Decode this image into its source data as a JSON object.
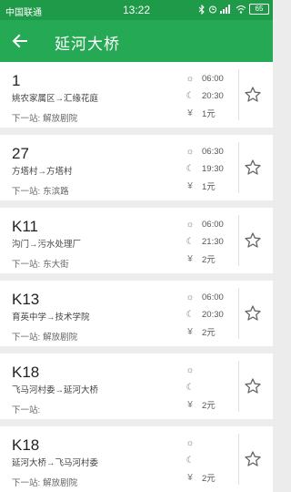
{
  "status_bar": {
    "carrier": "中国联通",
    "time": "13:22",
    "battery": "65"
  },
  "app_bar": {
    "title": "延河大桥"
  },
  "routes": [
    {
      "number": "1",
      "from": "姚农家属区",
      "arrow": "→",
      "to": "汇缘花庭",
      "next_label": "下一站:",
      "next_stop": "解放剧院",
      "first_bus": "06:00",
      "last_bus": "20:30",
      "fare": "1元"
    },
    {
      "number": "27",
      "from": "方塔村",
      "arrow": "→",
      "to": "方塔村",
      "next_label": "下一站:",
      "next_stop": "东滨路",
      "first_bus": "06:30",
      "last_bus": "19:30",
      "fare": "1元"
    },
    {
      "number": "K11",
      "from": "沟门",
      "arrow": "→",
      "to": "污水处理厂",
      "next_label": "下一站:",
      "next_stop": "东大街",
      "first_bus": "06:00",
      "last_bus": "21:30",
      "fare": "2元"
    },
    {
      "number": "K13",
      "from": "育英中学",
      "arrow": "→",
      "to": "技术学院",
      "next_label": "下一站:",
      "next_stop": "解放剧院",
      "first_bus": "06:00",
      "last_bus": "20:30",
      "fare": "2元"
    },
    {
      "number": "K18",
      "from": "飞马河村委",
      "arrow": "→",
      "to": "延河大桥",
      "next_label": "下一站:",
      "next_stop": "",
      "first_bus": "",
      "last_bus": "",
      "fare": "2元"
    },
    {
      "number": "K18",
      "from": "延河大桥",
      "arrow": "→",
      "to": "飞马河村委",
      "next_label": "下一站:",
      "next_stop": "解放剧院",
      "first_bus": "",
      "last_bus": "",
      "fare": "2元"
    }
  ],
  "icons": {
    "first_bus": "sun-icon",
    "last_bus": "moon-icon",
    "fare": "yen-icon",
    "favorite": "star-outline-icon"
  },
  "colors": {
    "status_bar": "#1e9a48",
    "app_bar": "#26a954"
  }
}
